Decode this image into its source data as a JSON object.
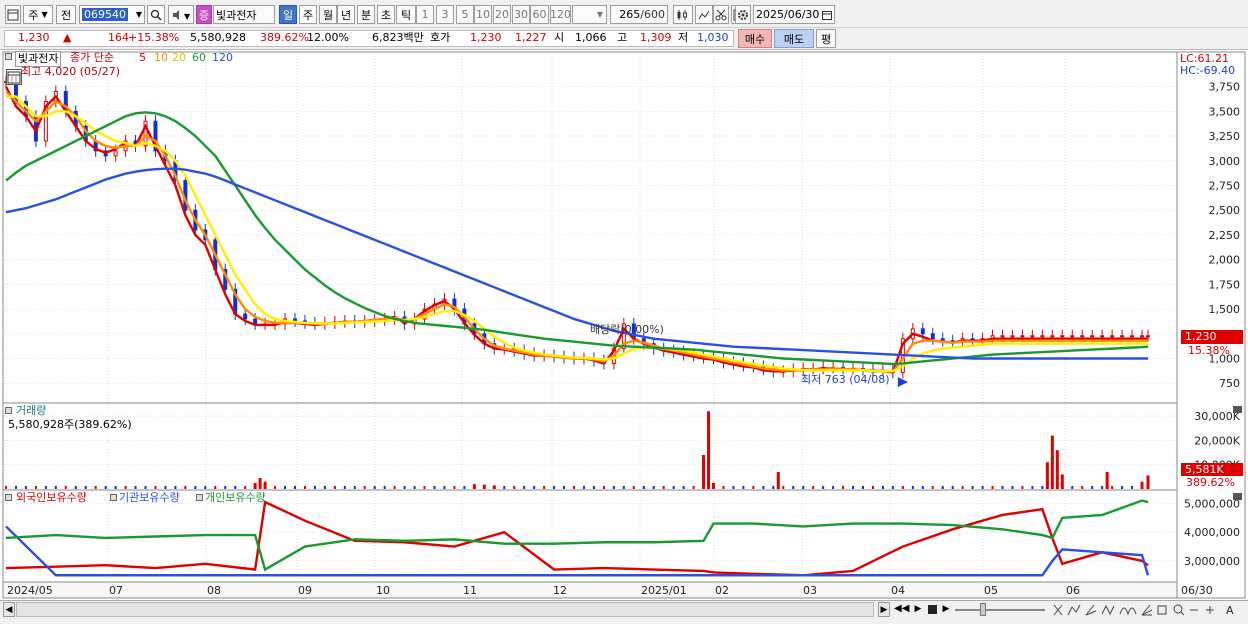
{
  "toolbar": {
    "period_main": "주",
    "prev_label": "전",
    "code": "069540",
    "badge": "증",
    "name": "빛과전자",
    "periods": [
      "일",
      "주",
      "월",
      "년",
      "분",
      "초",
      "틱"
    ],
    "period_selected": "일",
    "num_periods": [
      "1",
      "3",
      "5",
      "10",
      "20",
      "30",
      "60",
      "120"
    ],
    "count": "265",
    "count_total": "/600",
    "date": "2025/06/30"
  },
  "quote": {
    "price": "1,230",
    "change": "164",
    "change_rate": "+15.38%",
    "volume": "5,580,928",
    "vol_rate": "389.62%",
    "turnover": "12.00%",
    "amount": "6,823백만",
    "bid_label": "호가",
    "ask": "1,230",
    "bid": "1,227",
    "open_label": "시",
    "open": "1,066",
    "high_label": "고",
    "high": "1,309",
    "low_label": "저",
    "low": "1,030",
    "buy_label": "매수",
    "sell_label": "매도",
    "eval_label": "평"
  },
  "legend": {
    "name": "빛과전자",
    "ma_title": "종가 단순",
    "ma_periods": [
      "5",
      "10",
      "20",
      "60",
      "120"
    ],
    "high_note": "최고 4,020 (05/27)",
    "low_note": "최저 763 (04/08)",
    "dividend_note": "배당락(0.00%)",
    "lc": "LC:61.21",
    "hc": "HC:-69.40",
    "price_tag": "1,230",
    "pct_tag": "15.38%"
  },
  "volume_panel": {
    "title": "거래량",
    "value": "5,580,928주(389.62%)",
    "tag": "5,581K",
    "tag_pct": "389.62%"
  },
  "holding_panel": {
    "series": [
      "외국인보유수량",
      "기관보유수량",
      "개인보유수량"
    ]
  },
  "colors": {
    "ma5": "#e00000",
    "ma10": "#ff8c00",
    "ma20": "#ffee00",
    "ma60": "#1a9930",
    "ma120": "#2b4fe0",
    "up": "#e00000",
    "down": "#1030d0"
  },
  "chart_data": [
    {
      "type": "candlestick",
      "title": "빛과전자",
      "x_ticks": [
        "2024/05",
        "07",
        "08",
        "09",
        "10",
        "11",
        "12",
        "2025/01",
        "02",
        "03",
        "04",
        "05",
        "06",
        "06/30"
      ],
      "y_ticks": [
        750,
        1000,
        1250,
        1500,
        1750,
        2000,
        2250,
        2500,
        2750,
        3000,
        3250,
        3500,
        3750
      ],
      "y_tick_labels": [
        "750",
        "1,000",
        "1,250",
        "1,500",
        "1,750",
        "2,000",
        "2,250",
        "2,500",
        "2,750",
        "3,000",
        "3,250",
        "3,500",
        "3,750"
      ],
      "ylim": [
        550,
        4100
      ],
      "x": [
        0,
        10,
        20,
        30,
        40,
        50,
        60,
        70,
        80,
        90,
        100,
        110,
        120,
        130,
        140,
        150,
        160,
        170,
        180,
        190,
        200,
        210,
        220,
        230,
        240,
        250,
        260,
        270,
        280,
        290,
        300,
        310,
        320,
        330,
        340,
        350,
        360,
        370,
        380,
        390,
        400,
        410,
        420,
        430,
        440,
        450,
        460,
        470,
        480,
        490,
        500,
        510,
        520,
        530,
        540,
        550,
        560,
        570,
        580,
        590,
        600,
        610,
        620,
        630,
        640,
        650,
        660,
        670,
        680,
        690,
        700,
        710,
        720,
        730,
        740,
        750,
        760,
        770,
        780,
        790,
        800,
        810,
        820,
        830,
        840,
        850,
        860,
        870,
        880,
        890,
        900,
        910,
        920,
        930,
        940,
        950,
        960,
        970,
        980,
        990,
        1000,
        1010,
        1020,
        1030,
        1040,
        1050,
        1060,
        1070,
        1080,
        1090,
        1100,
        1110,
        1120,
        1130,
        1140,
        1146
      ],
      "close": [
        3800,
        3600,
        3450,
        3200,
        3600,
        3700,
        3500,
        3350,
        3200,
        3100,
        3050,
        3100,
        3200,
        3150,
        3400,
        3100,
        3000,
        2800,
        2500,
        2300,
        2200,
        1900,
        1700,
        1450,
        1400,
        1350,
        1350,
        1350,
        1400,
        1380,
        1360,
        1350,
        1360,
        1370,
        1380,
        1370,
        1380,
        1390,
        1400,
        1420,
        1350,
        1400,
        1500,
        1550,
        1600,
        1500,
        1350,
        1250,
        1150,
        1100,
        1100,
        1080,
        1050,
        1030,
        1030,
        1020,
        1010,
        1000,
        1000,
        980,
        950,
        1100,
        1350,
        1200,
        1150,
        1100,
        1080,
        1070,
        1040,
        1030,
        1010,
        1000,
        960,
        950,
        930,
        920,
        890,
        870,
        870,
        890,
        900,
        900,
        910,
        910,
        900,
        900,
        890,
        880,
        880,
        860,
        1200,
        1300,
        1250,
        1200,
        1180,
        1170,
        1200,
        1190,
        1200,
        1230,
        1230,
        1230,
        1230,
        1230,
        1230,
        1230,
        1230,
        1230,
        1230,
        1230,
        1230,
        1230,
        1230,
        1230,
        1230,
        1230
      ],
      "series": [
        {
          "name": "5",
          "values": [
            3750,
            3550,
            3450,
            3300,
            3550,
            3650,
            3500,
            3350,
            3200,
            3120,
            3080,
            3120,
            3180,
            3150,
            3350,
            3150,
            2950,
            2750,
            2450,
            2250,
            2150,
            1900,
            1650,
            1450,
            1380,
            1340,
            1340,
            1340,
            1370,
            1360,
            1350,
            1340,
            1350,
            1360,
            1370,
            1370,
            1380,
            1390,
            1400,
            1420,
            1360,
            1400,
            1480,
            1540,
            1580,
            1500,
            1360,
            1240,
            1150,
            1100,
            1090,
            1070,
            1050,
            1030,
            1030,
            1020,
            1010,
            1000,
            1000,
            980,
            950,
            1080,
            1300,
            1200,
            1150,
            1110,
            1080,
            1060,
            1040,
            1020,
            1000,
            990,
            960,
            940,
            920,
            910,
            880,
            870,
            870,
            880,
            890,
            890,
            900,
            900,
            890,
            890,
            880,
            870,
            870,
            860,
            1150,
            1250,
            1220,
            1180,
            1170,
            1160,
            1180,
            1180,
            1180,
            1200,
            1200,
            1200,
            1200,
            1200,
            1200,
            1200,
            1200,
            1200,
            1200,
            1200,
            1200,
            1200,
            1200,
            1200,
            1200,
            1200
          ]
        },
        {
          "name": "10",
          "values": [
            3700,
            3600,
            3500,
            3400,
            3500,
            3600,
            3550,
            3450,
            3300,
            3200,
            3150,
            3130,
            3150,
            3150,
            3250,
            3200,
            3050,
            2850,
            2600,
            2400,
            2250,
            2050,
            1850,
            1650,
            1500,
            1420,
            1380,
            1360,
            1360,
            1360,
            1360,
            1350,
            1350,
            1360,
            1370,
            1370,
            1380,
            1390,
            1400,
            1410,
            1390,
            1400,
            1450,
            1500,
            1550,
            1520,
            1420,
            1300,
            1200,
            1130,
            1100,
            1080,
            1060,
            1040,
            1030,
            1020,
            1010,
            1000,
            1000,
            990,
            970,
            1030,
            1150,
            1180,
            1160,
            1130,
            1100,
            1080,
            1060,
            1040,
            1020,
            1000,
            980,
            960,
            940,
            920,
            900,
            890,
            880,
            880,
            880,
            890,
            890,
            900,
            895,
            890,
            885,
            880,
            875,
            870,
            1000,
            1150,
            1180,
            1180,
            1170,
            1160,
            1170,
            1170,
            1170,
            1180,
            1180,
            1180,
            1180,
            1180,
            1180,
            1180,
            1180,
            1180,
            1180,
            1180,
            1180,
            1180,
            1180,
            1180,
            1180,
            1180
          ]
        },
        {
          "name": "20",
          "values": [
            3650,
            3650,
            3550,
            3450,
            3450,
            3500,
            3500,
            3450,
            3380,
            3300,
            3250,
            3200,
            3180,
            3150,
            3180,
            3150,
            3100,
            3000,
            2850,
            2650,
            2450,
            2250,
            2050,
            1850,
            1700,
            1550,
            1450,
            1400,
            1380,
            1370,
            1360,
            1360,
            1355,
            1355,
            1360,
            1365,
            1370,
            1375,
            1380,
            1390,
            1390,
            1400,
            1420,
            1450,
            1480,
            1480,
            1440,
            1380,
            1300,
            1220,
            1160,
            1110,
            1080,
            1060,
            1040,
            1030,
            1020,
            1010,
            1005,
            1000,
            990,
            1000,
            1050,
            1100,
            1110,
            1110,
            1100,
            1090,
            1080,
            1060,
            1040,
            1020,
            1000,
            980,
            960,
            945,
            930,
            915,
            900,
            890,
            885,
            880,
            880,
            880,
            880,
            880,
            880,
            875,
            870,
            870,
            920,
            1000,
            1050,
            1080,
            1100,
            1110,
            1120,
            1130,
            1140,
            1150,
            1150,
            1150,
            1150,
            1150,
            1150,
            1150,
            1150,
            1150,
            1150,
            1150,
            1150,
            1150,
            1150,
            1150,
            1150,
            1150
          ]
        },
        {
          "name": "60",
          "values": [
            2800,
            2880,
            2950,
            3000,
            3050,
            3100,
            3150,
            3200,
            3250,
            3300,
            3350,
            3400,
            3450,
            3480,
            3490,
            3480,
            3450,
            3400,
            3330,
            3250,
            3150,
            3050,
            2900,
            2750,
            2600,
            2450,
            2320,
            2200,
            2100,
            2000,
            1900,
            1820,
            1740,
            1670,
            1610,
            1560,
            1510,
            1470,
            1430,
            1400,
            1380,
            1360,
            1350,
            1340,
            1330,
            1320,
            1310,
            1300,
            1290,
            1275,
            1260,
            1245,
            1230,
            1215,
            1200,
            1190,
            1180,
            1170,
            1160,
            1150,
            1140,
            1130,
            1125,
            1120,
            1115,
            1110,
            1105,
            1100,
            1095,
            1090,
            1080,
            1070,
            1060,
            1050,
            1040,
            1030,
            1020,
            1010,
            1000,
            995,
            990,
            985,
            980,
            975,
            970,
            965,
            960,
            955,
            950,
            945,
            950,
            960,
            970,
            980,
            990,
            1000,
            1010,
            1020,
            1030,
            1040,
            1045,
            1050,
            1055,
            1060,
            1065,
            1070,
            1075,
            1080,
            1085,
            1090,
            1095,
            1100,
            1105,
            1110,
            1115,
            1120
          ]
        },
        {
          "name": "120",
          "values": [
            2480,
            2500,
            2520,
            2550,
            2580,
            2610,
            2650,
            2690,
            2730,
            2770,
            2810,
            2840,
            2870,
            2890,
            2905,
            2915,
            2920,
            2920,
            2910,
            2890,
            2870,
            2840,
            2800,
            2760,
            2720,
            2680,
            2640,
            2600,
            2560,
            2520,
            2480,
            2440,
            2400,
            2360,
            2320,
            2280,
            2240,
            2200,
            2160,
            2120,
            2080,
            2040,
            2000,
            1960,
            1920,
            1880,
            1840,
            1800,
            1760,
            1720,
            1680,
            1640,
            1600,
            1560,
            1520,
            1480,
            1440,
            1400,
            1370,
            1340,
            1310,
            1280,
            1260,
            1240,
            1220,
            1200,
            1190,
            1180,
            1170,
            1160,
            1150,
            1140,
            1130,
            1120,
            1115,
            1110,
            1105,
            1100,
            1095,
            1090,
            1085,
            1080,
            1075,
            1070,
            1065,
            1060,
            1055,
            1050,
            1045,
            1040,
            1035,
            1030,
            1025,
            1020,
            1015,
            1010,
            1005,
            1000,
            1000,
            1000,
            1000,
            1000,
            1000,
            1000,
            1000,
            1000,
            1000,
            1000,
            1000,
            1000,
            1000,
            1000,
            1000,
            1000,
            1000,
            1000
          ]
        }
      ]
    },
    {
      "type": "bar",
      "title": "거래량",
      "y_ticks": [
        10000,
        20000,
        30000
      ],
      "y_tick_labels": [
        "10,000K",
        "20,000K",
        "30,000K"
      ],
      "ylim": [
        0,
        35000
      ],
      "x": [
        250,
        255,
        260,
        470,
        480,
        490,
        700,
        705,
        710,
        775,
        1045,
        1050,
        1055,
        1060,
        1105,
        1140,
        1146
      ],
      "values": [
        2500,
        4500,
        3000,
        2000,
        1800,
        1500,
        14000,
        32000,
        2500,
        7000,
        11000,
        22000,
        16000,
        6000,
        7000,
        3000,
        5581
      ]
    },
    {
      "type": "line",
      "title": "보유수량",
      "y_ticks": [
        3000000,
        4000000,
        5000000
      ],
      "y_tick_labels": [
        "3,000,000",
        "4,000,000",
        "5,000,000"
      ],
      "ylim": [
        2300000,
        5400000
      ],
      "x": [
        0,
        50,
        100,
        150,
        200,
        250,
        260,
        300,
        350,
        400,
        450,
        500,
        550,
        600,
        650,
        700,
        710,
        750,
        800,
        850,
        900,
        950,
        1000,
        1040,
        1050,
        1060,
        1100,
        1140,
        1146
      ],
      "series": [
        {
          "name": "외국인보유수량",
          "values": [
            2750,
            2800,
            2850,
            2750,
            2900,
            2700,
            5050,
            4400,
            3700,
            3650,
            3500,
            4000,
            2700,
            2750,
            2700,
            2650,
            2600,
            2550,
            2500,
            2650,
            3500,
            4100,
            4600,
            4800,
            3800,
            2900,
            3300,
            3000,
            2850
          ]
        },
        {
          "name": "기관보유수량",
          "values": [
            4200,
            2500,
            2500,
            2500,
            2500,
            2500,
            2500,
            2500,
            2500,
            2500,
            2500,
            2500,
            2500,
            2500,
            2500,
            2500,
            2500,
            2500,
            2500,
            2500,
            2500,
            2500,
            2500,
            2500,
            3000,
            3400,
            3300,
            3200,
            2500
          ]
        },
        {
          "name": "개인보유수량",
          "values": [
            3800,
            3900,
            3800,
            3850,
            3900,
            3900,
            2700,
            3500,
            3750,
            3700,
            3750,
            3600,
            3600,
            3650,
            3650,
            3700,
            4300,
            4300,
            4200,
            4300,
            4300,
            4250,
            4100,
            3900,
            3800,
            4500,
            4600,
            5100,
            5050
          ]
        }
      ]
    }
  ]
}
